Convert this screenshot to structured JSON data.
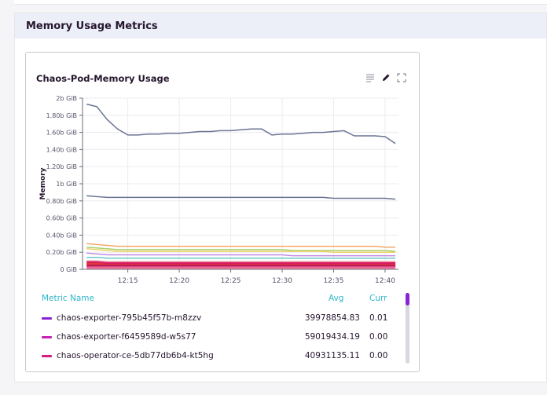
{
  "section": {
    "title": "Memory Usage Metrics"
  },
  "card": {
    "title": "Chaos-Pod-Memory Usage",
    "tools": [
      "list-icon",
      "pencil-icon",
      "expand-icon"
    ]
  },
  "chart_data": {
    "type": "line",
    "title": "Chaos-Pod-Memory Usage",
    "ylabel": "Memory",
    "xlabel": "",
    "ylim": [
      0,
      2
    ],
    "y_ticks": [
      "0 GiB",
      "0.20b GiB",
      "0.40b GiB",
      "0.60b GiB",
      "0.80b GiB",
      "1b GiB",
      "1.20b GiB",
      "1.40b GiB",
      "1.60b GiB",
      "1.80b GiB",
      "2b GiB"
    ],
    "x_ticks": [
      "12:15",
      "12:20",
      "12:25",
      "12:30",
      "12:35",
      "12:40"
    ],
    "grid": true,
    "x": [
      "12:11",
      "12:12",
      "12:13",
      "12:14",
      "12:15",
      "12:16",
      "12:17",
      "12:18",
      "12:19",
      "12:20",
      "12:21",
      "12:22",
      "12:23",
      "12:24",
      "12:25",
      "12:26",
      "12:27",
      "12:28",
      "12:29",
      "12:30",
      "12:31",
      "12:32",
      "12:33",
      "12:34",
      "12:35",
      "12:36",
      "12:37",
      "12:38",
      "12:39",
      "12:40",
      "12:41"
    ],
    "series": [
      {
        "color": "#6b7494",
        "values": [
          1.93,
          1.9,
          1.75,
          1.64,
          1.57,
          1.57,
          1.58,
          1.58,
          1.59,
          1.59,
          1.6,
          1.61,
          1.61,
          1.62,
          1.62,
          1.63,
          1.64,
          1.64,
          1.57,
          1.58,
          1.58,
          1.59,
          1.6,
          1.6,
          1.61,
          1.62,
          1.56,
          1.56,
          1.56,
          1.55,
          1.47
        ]
      },
      {
        "color": "#6b7494",
        "values": [
          0.86,
          0.85,
          0.84,
          0.84,
          0.84,
          0.84,
          0.84,
          0.84,
          0.84,
          0.84,
          0.84,
          0.84,
          0.84,
          0.84,
          0.84,
          0.84,
          0.84,
          0.84,
          0.84,
          0.84,
          0.84,
          0.84,
          0.84,
          0.84,
          0.83,
          0.83,
          0.83,
          0.83,
          0.83,
          0.83,
          0.82
        ]
      },
      {
        "color": "#f2a86b",
        "values": [
          0.3,
          0.29,
          0.28,
          0.27,
          0.27,
          0.27,
          0.27,
          0.27,
          0.27,
          0.27,
          0.27,
          0.27,
          0.27,
          0.27,
          0.27,
          0.27,
          0.27,
          0.27,
          0.27,
          0.27,
          0.27,
          0.27,
          0.27,
          0.27,
          0.27,
          0.27,
          0.27,
          0.27,
          0.27,
          0.26,
          0.26
        ]
      },
      {
        "color": "#a6d06b",
        "values": [
          0.26,
          0.25,
          0.24,
          0.23,
          0.23,
          0.23,
          0.23,
          0.23,
          0.23,
          0.23,
          0.23,
          0.23,
          0.23,
          0.23,
          0.23,
          0.23,
          0.23,
          0.23,
          0.23,
          0.23,
          0.22,
          0.22,
          0.22,
          0.22,
          0.22,
          0.22,
          0.22,
          0.22,
          0.22,
          0.22,
          0.21
        ]
      },
      {
        "color": "#f0cf6a",
        "values": [
          0.24,
          0.23,
          0.22,
          0.21,
          0.21,
          0.21,
          0.21,
          0.21,
          0.21,
          0.21,
          0.21,
          0.21,
          0.21,
          0.21,
          0.21,
          0.21,
          0.21,
          0.21,
          0.21,
          0.21,
          0.21,
          0.21,
          0.21,
          0.21,
          0.2,
          0.2,
          0.2,
          0.2,
          0.2,
          0.2,
          0.2
        ]
      },
      {
        "color": "#c38de0",
        "values": [
          0.19,
          0.18,
          0.17,
          0.17,
          0.17,
          0.17,
          0.17,
          0.17,
          0.17,
          0.17,
          0.17,
          0.17,
          0.17,
          0.17,
          0.17,
          0.17,
          0.17,
          0.17,
          0.17,
          0.17,
          0.16,
          0.16,
          0.16,
          0.16,
          0.16,
          0.16,
          0.16,
          0.16,
          0.16,
          0.16,
          0.16
        ]
      },
      {
        "color": "#6fc7c7",
        "values": [
          0.14,
          0.14,
          0.13,
          0.13,
          0.13,
          0.13,
          0.13,
          0.13,
          0.13,
          0.13,
          0.13,
          0.13,
          0.13,
          0.13,
          0.13,
          0.13,
          0.13,
          0.13,
          0.13,
          0.13,
          0.13,
          0.13,
          0.13,
          0.13,
          0.13,
          0.13,
          0.13,
          0.13,
          0.13,
          0.13,
          0.13
        ]
      },
      {
        "color": "#ef9aa0",
        "values": [
          0.1,
          0.1,
          0.09,
          0.09,
          0.09,
          0.09,
          0.09,
          0.09,
          0.09,
          0.09,
          0.09,
          0.09,
          0.09,
          0.09,
          0.09,
          0.09,
          0.09,
          0.09,
          0.09,
          0.09,
          0.09,
          0.09,
          0.09,
          0.09,
          0.09,
          0.09,
          0.09,
          0.09,
          0.09,
          0.09,
          0.09
        ]
      },
      {
        "color": "#d81b60",
        "values": [
          0.08,
          0.08,
          0.07,
          0.07,
          0.07,
          0.07,
          0.07,
          0.07,
          0.07,
          0.07,
          0.07,
          0.07,
          0.07,
          0.07,
          0.07,
          0.07,
          0.07,
          0.07,
          0.07,
          0.07,
          0.07,
          0.07,
          0.07,
          0.07,
          0.07,
          0.07,
          0.07,
          0.07,
          0.07,
          0.07,
          0.07
        ]
      },
      {
        "color": "#e53935",
        "values": [
          0.06,
          0.06,
          0.05,
          0.05,
          0.05,
          0.05,
          0.05,
          0.05,
          0.05,
          0.05,
          0.05,
          0.05,
          0.05,
          0.05,
          0.05,
          0.05,
          0.05,
          0.05,
          0.05,
          0.05,
          0.05,
          0.05,
          0.05,
          0.05,
          0.05,
          0.05,
          0.05,
          0.05,
          0.05,
          0.05,
          0.05
        ]
      },
      {
        "color": "#b5185a",
        "values": [
          0.04,
          0.04,
          0.04,
          0.04,
          0.04,
          0.04,
          0.04,
          0.04,
          0.04,
          0.04,
          0.04,
          0.04,
          0.04,
          0.04,
          0.04,
          0.04,
          0.04,
          0.04,
          0.04,
          0.04,
          0.04,
          0.04,
          0.04,
          0.04,
          0.04,
          0.04,
          0.04,
          0.04,
          0.04,
          0.04,
          0.04
        ]
      },
      {
        "color": "#f06292",
        "values": [
          0.02,
          0.02,
          0.02,
          0.02,
          0.02,
          0.02,
          0.02,
          0.02,
          0.02,
          0.02,
          0.02,
          0.02,
          0.02,
          0.02,
          0.02,
          0.02,
          0.02,
          0.02,
          0.02,
          0.02,
          0.02,
          0.02,
          0.02,
          0.02,
          0.02,
          0.02,
          0.02,
          0.02,
          0.02,
          0.02,
          0.02
        ]
      }
    ]
  },
  "legend": {
    "headers": {
      "name": "Metric Name",
      "avg": "Avg",
      "curr": "Curr"
    },
    "rows": [
      {
        "name": "chaos-exporter-795b45f57b-m8zzv",
        "avg": "39978854.83",
        "curr": "0.01",
        "color": "#8a23d8"
      },
      {
        "name": "chaos-exporter-f6459589d-w5s77",
        "avg": "59019434.19",
        "curr": "0.00",
        "color": "#c724b1"
      },
      {
        "name": "chaos-operator-ce-5db77db6b4-kt5hg",
        "avg": "40931135.11",
        "curr": "0.00",
        "color": "#d81b80"
      }
    ]
  }
}
